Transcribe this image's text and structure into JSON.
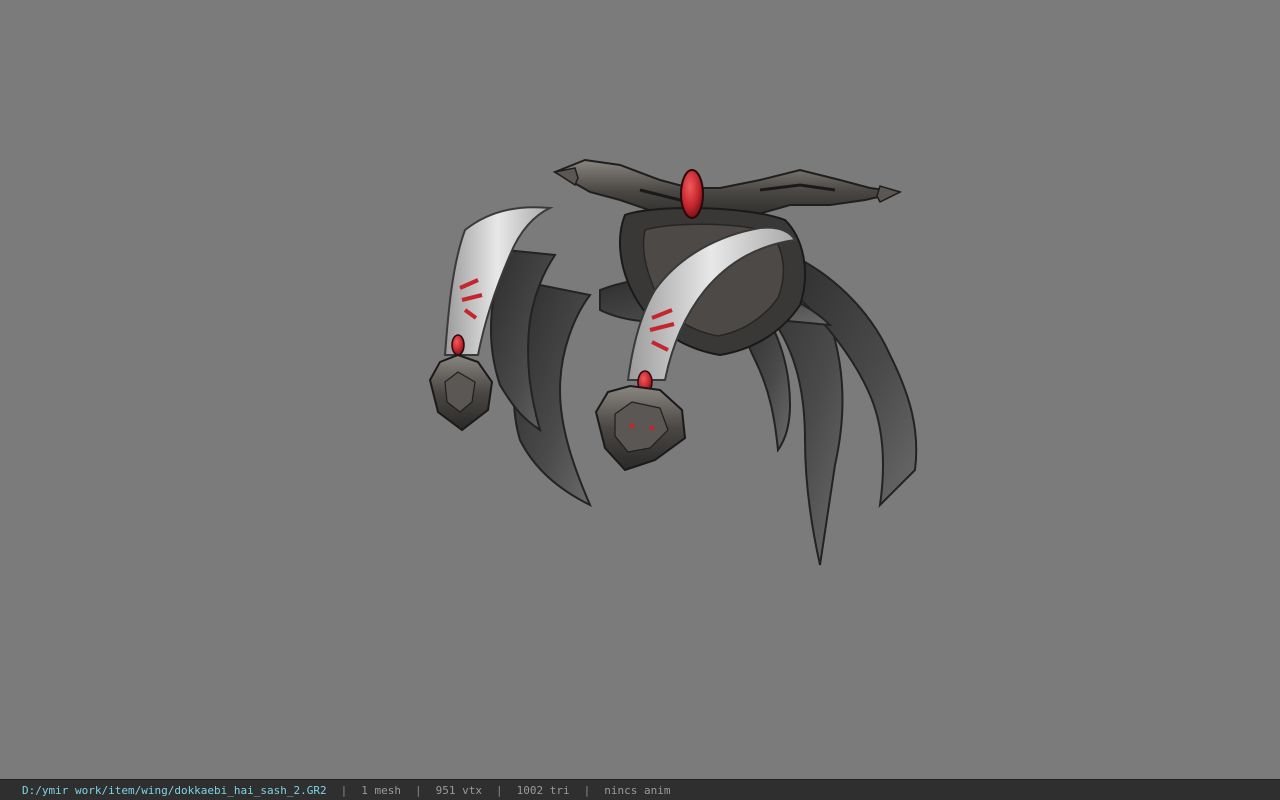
{
  "viewer": {
    "background_color": "#7b7b7b",
    "model_icon": "wing-sash-model",
    "accent_color": "#c4262e"
  },
  "status": {
    "path": "D:/ymir work/item/wing/dokkaebi_hai_sash_2.GR2",
    "mesh": "1 mesh",
    "vertices": "951 vtx",
    "triangles": "1002 tri",
    "anim": "nincs anim",
    "separator": "|"
  }
}
